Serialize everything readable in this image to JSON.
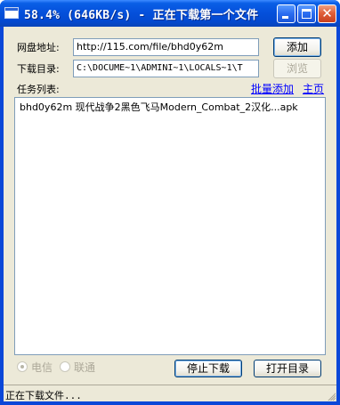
{
  "window": {
    "title": "58.4% (646KB/s) - 正在下载第一个文件"
  },
  "form": {
    "netdisk_label": "网盘地址:",
    "netdisk_value": "http://115.com/file/bhd0y62m",
    "add_button": "添加",
    "dir_label": "下载目录:",
    "dir_value": "C:\\DOCUME~1\\ADMINI~1\\LOCALS~1\\T",
    "browse_button": "浏览",
    "task_list_label": "任务列表:",
    "batch_add_link": "批量添加",
    "home_link": "主页"
  },
  "task_list": {
    "items": [
      {
        "text": "bhd0y62m  现代战争2黑色飞马Modern_Combat_2汉化...apk"
      }
    ]
  },
  "network": {
    "options": [
      "电信",
      "联通"
    ],
    "selected": "电信",
    "enabled": false
  },
  "actions": {
    "stop_button": "停止下载",
    "open_dir_button": "打开目录"
  },
  "status": {
    "text": "正在下载文件..."
  }
}
